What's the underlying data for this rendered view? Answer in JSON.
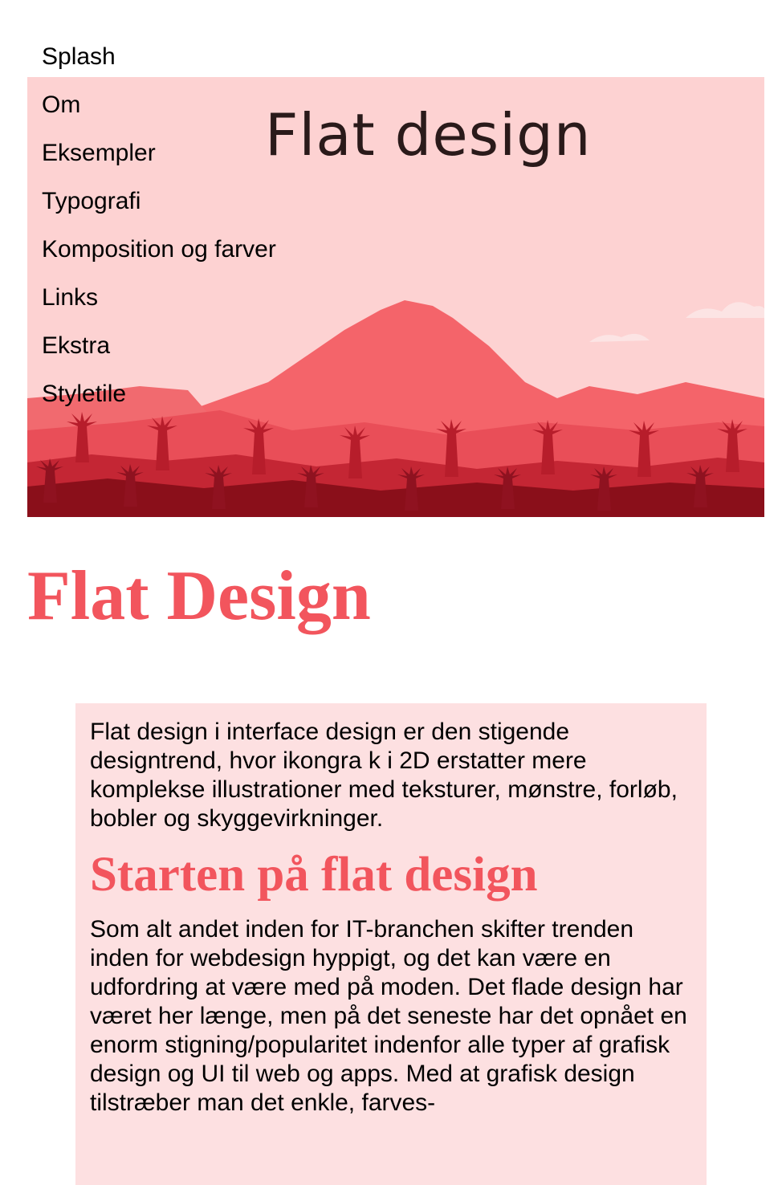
{
  "nav": {
    "items": [
      {
        "label": "Splash"
      },
      {
        "label": "Om"
      },
      {
        "label": "Eksempler"
      },
      {
        "label": "Typografi"
      },
      {
        "label": "Komposition og farver"
      },
      {
        "label": "Links"
      },
      {
        "label": "Ekstra"
      },
      {
        "label": "Styletile"
      }
    ]
  },
  "hero": {
    "title": "Flat design",
    "colors": {
      "sky": "#fdd2d2",
      "mountain": "#f4646a",
      "hills": "#e64b55",
      "foreground": "#b8202d",
      "front": "#8a0f1a"
    }
  },
  "page": {
    "title": "Flat Design",
    "accent": "#f2555d"
  },
  "content": {
    "intro": "Flat design i interface design er den stigende designtrend, hvor ikongra k i 2D erstatter mere komplekse illustrationer med teksturer, mønstre, forløb, bobler og skyggevirkninger.",
    "section_heading": "Starten på flat design",
    "section_text": "Som alt andet inden for IT-branchen skifter trenden inden for webdesign hyppigt, og det kan være en udfordring at være med på moden. Det flade design har været her længe, men på det seneste har det opnået en enorm stigning/popularitet indenfor alle typer af grafisk design og UI til web og apps. Med at grafisk design tilstræber man det enkle, farves-"
  }
}
